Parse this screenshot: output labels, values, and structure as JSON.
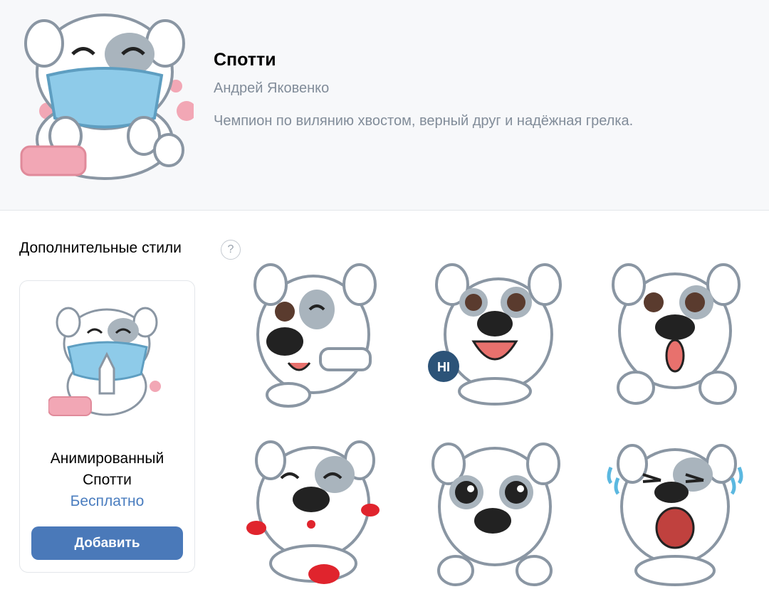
{
  "pack": {
    "title": "Спотти",
    "author": "Андрей Яковенко",
    "description": "Чемпион по вилянию хвостом, верный друг и надёжная грелка.",
    "cover_icon": "dog-sticker-mask"
  },
  "styles": {
    "heading": "Дополнительные стили",
    "help_symbol": "?",
    "card": {
      "name_line1": "Анимированный",
      "name_line2": "Спотти",
      "price": "Бесплатно",
      "button": "Добавить",
      "icon": "dog-sticker-mask-praying"
    }
  },
  "stickers": [
    {
      "icon": "dog-wink-pointing"
    },
    {
      "icon": "dog-hi-bubble",
      "bubble_text": "HI"
    },
    {
      "icon": "dog-tongue-out"
    },
    {
      "icon": "dog-kisses"
    },
    {
      "icon": "dog-sad-eyes"
    },
    {
      "icon": "dog-crying"
    }
  ],
  "colors": {
    "button": "#4a79b9",
    "price": "#4a7dbf",
    "secondary_text": "#818c99",
    "header_bg": "#f7f8fa",
    "mask": "#8ecbe9",
    "kiss": "#e0242d",
    "tear": "#5bb8e0",
    "bubble": "#2c5378"
  }
}
